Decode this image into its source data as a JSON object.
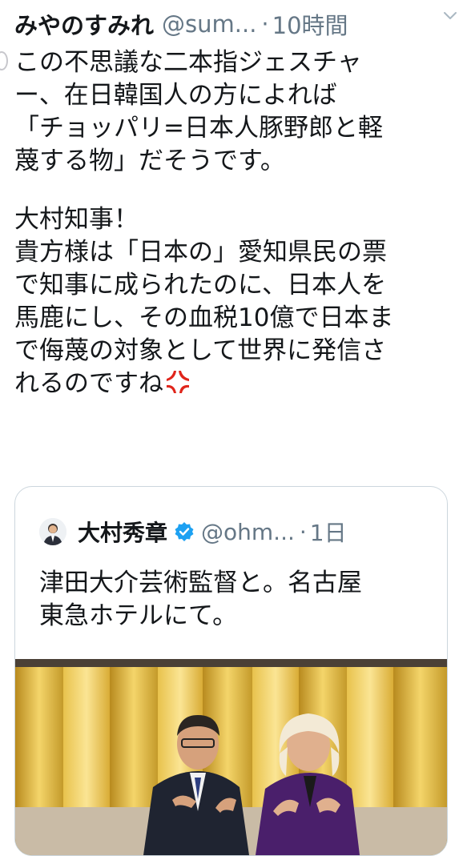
{
  "tweet": {
    "display_name": "みやのすみれ",
    "handle": "@sum...",
    "separator": "·",
    "time": "10時間",
    "lines": [
      "この不思議な二本指ジェスチャ",
      "ー、在日韓国人の方によれば",
      "「チョッパリ=日本人豚野郎と軽",
      "蔑する物」だそうです。",
      "",
      "大村知事！",
      "貴方様は「日本の」愛知県民の票",
      "で知事に成られたのに、日本人を",
      "馬鹿にし、その血税10億で日本ま",
      "で侮蔑の対象として世界に発信さ",
      "れるのですね"
    ],
    "emoji": "anger-symbol-icon"
  },
  "quoted_tweet": {
    "display_name": "大村秀章",
    "handle": "@ohm...",
    "separator": "·",
    "time": "1日",
    "lines": [
      "津田大介芸術監督と。名古屋",
      "東急ホテルにて。"
    ],
    "verified": true
  },
  "colors": {
    "text": "#14171a",
    "secondary": "#657786",
    "verified": "#1da1f2",
    "border": "#ccd6dd",
    "anger": "#e0251b"
  }
}
